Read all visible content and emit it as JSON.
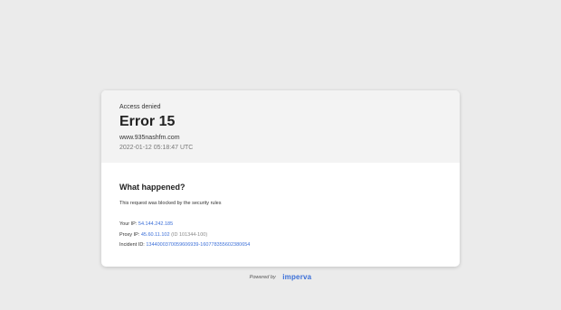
{
  "header": {
    "access_label": "Access denied",
    "error_title": "Error 15",
    "domain": "www.935nashfm.com",
    "timestamp": "2022-01-12 05:18:47 UTC"
  },
  "body": {
    "heading": "What happened?",
    "message": "This request was blocked by the security rules"
  },
  "info": {
    "your_ip_label": "Your IP:",
    "your_ip_value": "54.144.242.185",
    "proxy_ip_label": "Proxy IP:",
    "proxy_ip_value": "45.60.11.102",
    "proxy_ip_extra": "(ID 101344-100)",
    "incident_label": "Incident ID:",
    "incident_value": "1344000370059606939-160778355602380654"
  },
  "footer": {
    "powered_by": "Powered by",
    "brand": "imperva"
  },
  "colors": {
    "link": "#3b6fd8",
    "background": "#ebebeb",
    "header_bg": "#f3f3f3"
  }
}
